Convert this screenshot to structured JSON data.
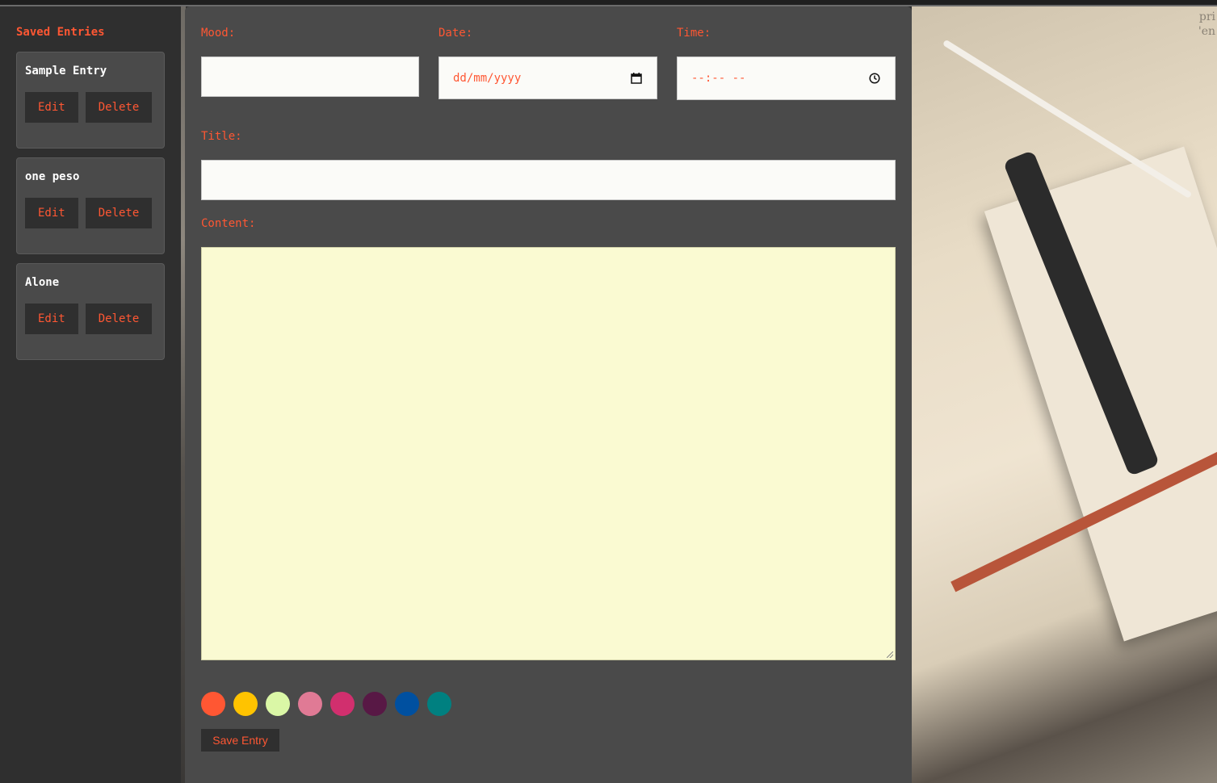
{
  "sidebar": {
    "title": "Saved Entries",
    "entries": [
      {
        "title": "Sample Entry",
        "edit_label": "Edit",
        "delete_label": "Delete"
      },
      {
        "title": "one peso",
        "edit_label": "Edit",
        "delete_label": "Delete"
      },
      {
        "title": "Alone",
        "edit_label": "Edit",
        "delete_label": "Delete"
      }
    ]
  },
  "form": {
    "mood_label": "Mood:",
    "mood_value": "",
    "date_label": "Date:",
    "date_placeholder": "dd/mm/yyyy",
    "time_label": "Time:",
    "time_placeholder": "--:-- --",
    "title_label": "Title:",
    "title_value": "",
    "content_label": "Content:",
    "content_value": "",
    "save_label": "Save Entry"
  },
  "swatches": [
    "#ff5733",
    "#ffc300",
    "#daf7a6",
    "#e07a95",
    "#d12f6e",
    "#581845",
    "#0050a0",
    "#008080"
  ],
  "background": {
    "corner_text_line1": "pri",
    "corner_text_line2": "'en"
  },
  "colors": {
    "accent": "#ff5733",
    "sidebar_bg": "#2f2f2f",
    "panel_bg": "#4a4a4a",
    "content_bg": "#fafad2"
  }
}
